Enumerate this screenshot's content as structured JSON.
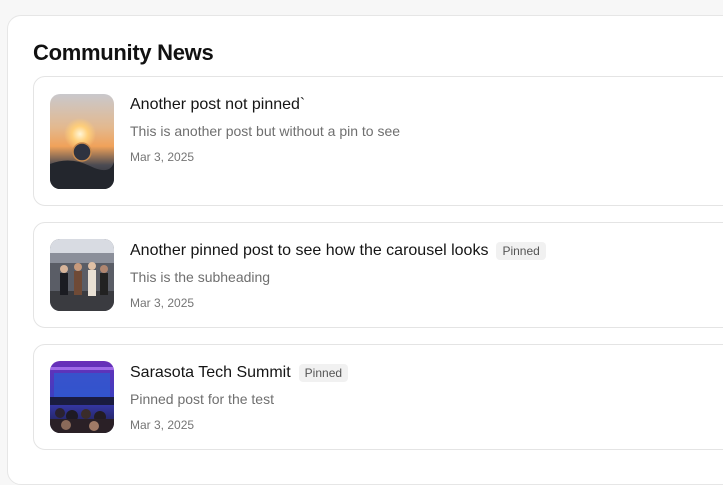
{
  "section": {
    "title": "Community News"
  },
  "posts": [
    {
      "title": "Another post not pinned`",
      "subheading": "This is another post but without a pin to see",
      "date": "Mar 3, 2025",
      "pinned": false,
      "badge": ""
    },
    {
      "title": "Another pinned post to see how the carousel looks",
      "subheading": "This is the subheading",
      "date": "Mar 3, 2025",
      "pinned": true,
      "badge": "Pinned"
    },
    {
      "title": "Sarasota Tech Summit",
      "subheading": "Pinned post for the test",
      "date": "Mar 3, 2025",
      "pinned": true,
      "badge": "Pinned"
    }
  ]
}
